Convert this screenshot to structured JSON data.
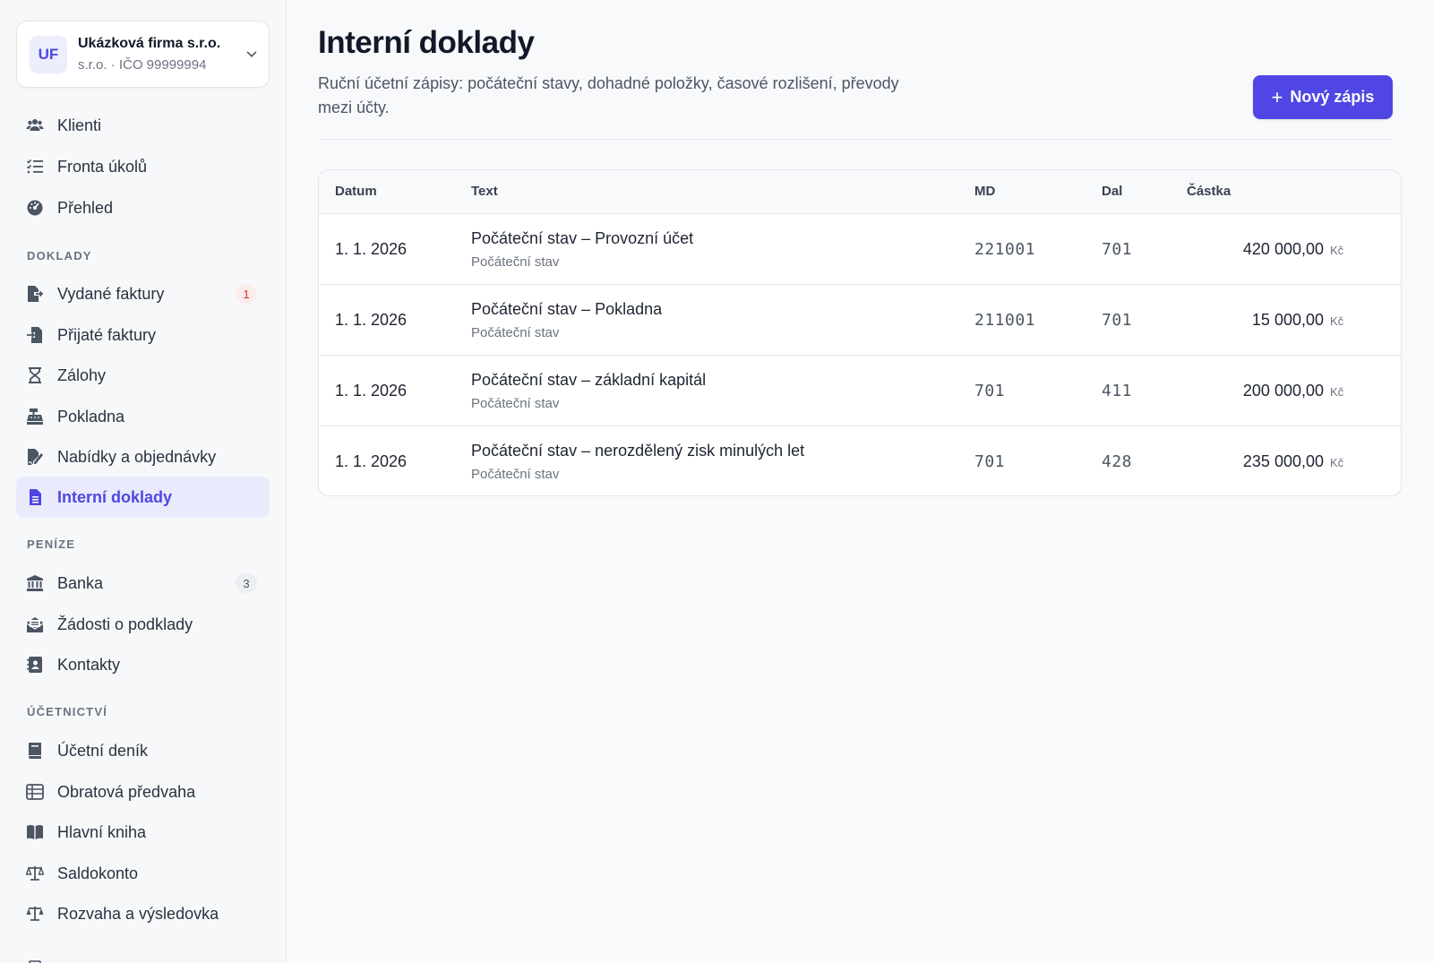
{
  "org": {
    "initials": "UF",
    "name": "Ukázková firma s.r.o.",
    "subtitle": "s.r.o. · IČO 99999994"
  },
  "nav_top": [
    {
      "label": "Klienti",
      "icon": "users-icon"
    },
    {
      "label": "Fronta úkolů",
      "icon": "task-list-icon"
    },
    {
      "label": "Přehled",
      "icon": "gauge-icon"
    }
  ],
  "sections": {
    "doklady": "DOKLADY",
    "penize": "PENÍZE",
    "ucetnictvi": "ÚČETNICTVÍ"
  },
  "nav_doklady": [
    {
      "label": "Vydané faktury",
      "icon": "file-export-icon",
      "badge": "1"
    },
    {
      "label": "Přijaté faktury",
      "icon": "file-import-icon"
    },
    {
      "label": "Zálohy",
      "icon": "hourglass-icon"
    },
    {
      "label": "Pokladna",
      "icon": "cash-register-icon"
    },
    {
      "label": "Nabídky a objednávky",
      "icon": "file-signature-icon"
    },
    {
      "label": "Interní doklady",
      "icon": "file-lines-icon",
      "active": true
    }
  ],
  "nav_penize": [
    {
      "label": "Banka",
      "icon": "bank-icon",
      "badge": "3"
    },
    {
      "label": "Žádosti o podklady",
      "icon": "envelope-open-icon"
    },
    {
      "label": "Kontakty",
      "icon": "address-book-icon"
    }
  ],
  "nav_ucetnictvi": [
    {
      "label": "Účetní deník",
      "icon": "book-icon"
    },
    {
      "label": "Obratová předvaha",
      "icon": "table-list-icon"
    },
    {
      "label": "Hlavní kniha",
      "icon": "book-open-icon"
    },
    {
      "label": "Saldokonto",
      "icon": "scale-icon"
    },
    {
      "label": "Rozvaha a výsledovka",
      "icon": "scale-balanced-icon"
    }
  ],
  "page": {
    "title": "Interní doklady",
    "description": "Ruční účetní zápisy: počáteční stavy, dohadné položky, časové rozlišení, převody mezi účty.",
    "new_button": "Nový zápis"
  },
  "table": {
    "headers": {
      "date": "Datum",
      "text": "Text",
      "md": "MD",
      "dal": "Dal",
      "amount": "Částka"
    },
    "rows": [
      {
        "date": "1. 1. 2026",
        "text": "Počáteční stav – Provozní účet",
        "sub": "Počáteční stav",
        "md": "221001",
        "dal": "701",
        "amount": "420 000,00",
        "currency": "Kč"
      },
      {
        "date": "1. 1. 2026",
        "text": "Počáteční stav – Pokladna",
        "sub": "Počáteční stav",
        "md": "211001",
        "dal": "701",
        "amount": "15 000,00",
        "currency": "Kč"
      },
      {
        "date": "1. 1. 2026",
        "text": "Počáteční stav – základní kapitál",
        "sub": "Počáteční stav",
        "md": "701",
        "dal": "411",
        "amount": "200 000,00",
        "currency": "Kč"
      },
      {
        "date": "1. 1. 2026",
        "text": "Počáteční stav – nerozdělený zisk minulých let",
        "sub": "Počáteční stav",
        "md": "701",
        "dal": "428",
        "amount": "235 000,00",
        "currency": "Kč"
      }
    ]
  },
  "colors": {
    "accent": "#4f46e5",
    "active_bg": "#e9ebfc",
    "badge_red": "#dc2626"
  }
}
